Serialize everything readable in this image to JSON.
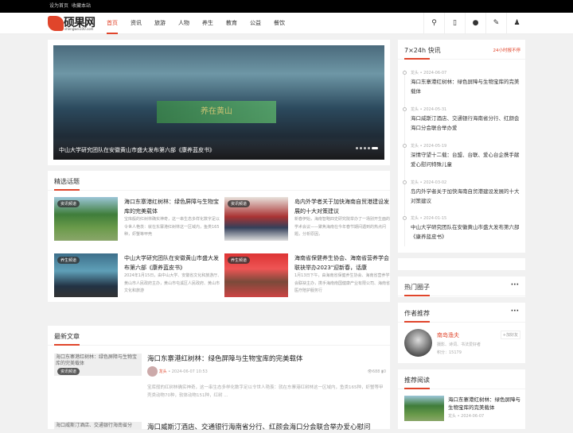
{
  "topbar": {
    "links": [
      "设为首页",
      "收藏本站"
    ]
  },
  "logo": {
    "text": "硕果网",
    "sub": "shengwei100.com"
  },
  "nav": {
    "items": [
      "首页",
      "资讯",
      "旅游",
      "人物",
      "养生",
      "教育",
      "公益",
      "餐饮"
    ],
    "active": 0,
    "icons": [
      "search-icon",
      "mobile-icon",
      "wechat-icon",
      "edit-icon",
      "user-icon"
    ]
  },
  "slider": {
    "caption": "中山大学研究团队在安徽黄山市盛大发布第六部《康养蓝皮书》",
    "banner": "养在黄山",
    "slide_count": 5,
    "active_slide": 5
  },
  "featured": {
    "title": "精选话题",
    "items": [
      {
        "tag": "资讯频道",
        "title": "海口东寨港红树林：绿色屏障与生物宝库的完美载体",
        "desc": "宝库般的红树林确实神奇，这一串生态多样化数字足以令世人艳羡：就在东寨港红树林这一区域内，鱼类165种，虾蟹等甲壳"
      },
      {
        "tag": "资讯频道",
        "title": "岛内外学者关于加快海南自贸港建设发展的十大对策建议",
        "desc": "新春伊始，海南智略四史研究院举办了一场别开生面的学术会议——聚焦海南在今年春节期间遇到的热点问题，分析原因，"
      },
      {
        "tag": "养生频道",
        "title": "中山大学研究团队在安徽黄山市盛大发布第六部《康养蓝皮书》",
        "desc": "2024年1月15日，由中山大学、安徽省文化和旅游厅、黄山市人民政府主办，黄山市屯溪区人民政府、黄山市文化和旅游"
      },
      {
        "tag": "养生频道",
        "title": "海南省保健养生协会、海南省营养学会联袂举办2023\"迎新春，话康",
        "desc": "1月13日下午，由海南省保健养生协会、海南省营养学会联袂主办，携手海南南国健康产业有限公司、海南省医疗陪护服务行"
      }
    ]
  },
  "latest": {
    "title": "最新文章",
    "items": [
      {
        "tag": "资讯频道",
        "img_alt": "海口东寨港红树林：绿色屏障与生物宝库的完美载体",
        "title": "海口东寨港红树林：绿色屏障与生物宝库的完美载体",
        "author": "龙头",
        "date": "2024-06-07 10:53",
        "views": "688",
        "comments": "0",
        "desc": "宝库般的红树林确实神奇，这一串生态多样化数字足以令世人艳羡：就在东寨港红树林这一区域内，鱼类165种，虾蟹等甲壳类动物70种，软体动物151种，红树 ..."
      },
      {
        "img_alt": "海口威斯汀酒店、交通银行海南省分",
        "title": "海口威斯汀酒店、交通银行海南省分行、红颜会海口分会联合举办爱心慰问"
      }
    ]
  },
  "flash": {
    "title": "7×24h 快讯",
    "badge": "24小时报不停",
    "items": [
      {
        "author": "龙头",
        "date": "2024-06-07",
        "title": "海口东寨港红树林：绿色屏障与生物宝库的完美载体"
      },
      {
        "author": "龙头",
        "date": "2024-05-31",
        "title": "海口威斯汀酒店、交通银行海南省分行、红颜会海口分会联合举办爱"
      },
      {
        "author": "龙头",
        "date": "2024-05-19",
        "title": "深情守望十二载：台盟、台联、爱心台企携手献爱心慰问特殊儿童"
      },
      {
        "author": "龙头",
        "date": "2024-03-02",
        "title": "岛内外学者关于加快海南自贸港建设发展的十大对策建议"
      },
      {
        "author": "龙头",
        "date": "2024-01-15",
        "title": "中山大学研究团队在安徽黄山市盛大发布第六部《康养蓝皮书》"
      }
    ]
  },
  "circles": {
    "title": "热门圈子"
  },
  "authors": {
    "title": "作者推荐",
    "name": "南岛渔夫",
    "bio": "摄影、诗词、书法爱好者",
    "score": "积分：15179",
    "add": "+加好友"
  },
  "recommend": {
    "title": "推荐阅读",
    "items": [
      {
        "title": "海口东寨港红树林：绿色屏障与生物宝库的完美载体",
        "author": "龙头",
        "date": "2024-06-07"
      }
    ]
  },
  "colors": {
    "accent": "#e0452b"
  }
}
